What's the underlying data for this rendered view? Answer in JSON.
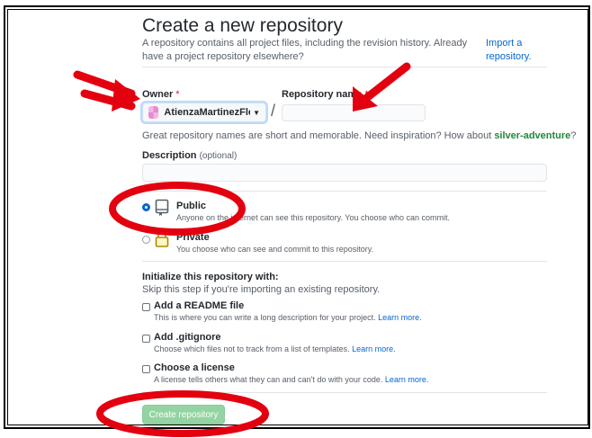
{
  "page": {
    "title": "Create a new repository",
    "subtitle": "A repository contains all project files, including the revision history. Already have a project repository elsewhere?",
    "import_link": "Import a repository."
  },
  "owner": {
    "label": "Owner",
    "required_mark": "*",
    "value": "AtienzaMartinezFloren"
  },
  "repo_name": {
    "label": "Repository name",
    "required_mark": "*",
    "value": ""
  },
  "slash": "/",
  "name_hint": {
    "text": "Great repository names are short and memorable. Need inspiration? How about ",
    "suggestion": "silver-adventure",
    "suffix": "?"
  },
  "description": {
    "label": "Description",
    "optional": "(optional)",
    "value": ""
  },
  "visibility": {
    "public": {
      "title": "Public",
      "desc": "Anyone on the internet can see this repository. You choose who can commit.",
      "selected": true
    },
    "private": {
      "title": "Private",
      "desc": "You choose who can see and commit to this repository.",
      "selected": false
    }
  },
  "initialize": {
    "title": "Initialize this repository with:",
    "subtitle": "Skip this step if you're importing an existing repository.",
    "readme": {
      "title": "Add a README file",
      "desc": "This is where you can write a long description for your project.",
      "link": "Learn more."
    },
    "gitignore": {
      "title": "Add .gitignore",
      "desc": "Choose which files not to track from a list of templates.",
      "link": "Learn more."
    },
    "license": {
      "title": "Choose a license",
      "desc": "A license tells others what they can and can't do with your code.",
      "link": "Learn more."
    }
  },
  "submit": {
    "label": "Create repository"
  },
  "colors": {
    "annotation_red": "#e3000f",
    "link_blue": "#0366d6",
    "button_green_disabled": "#94d3a2"
  },
  "icons": {
    "public": "repo-icon",
    "private": "lock-icon",
    "owner_caret": "triangle-down-icon"
  }
}
